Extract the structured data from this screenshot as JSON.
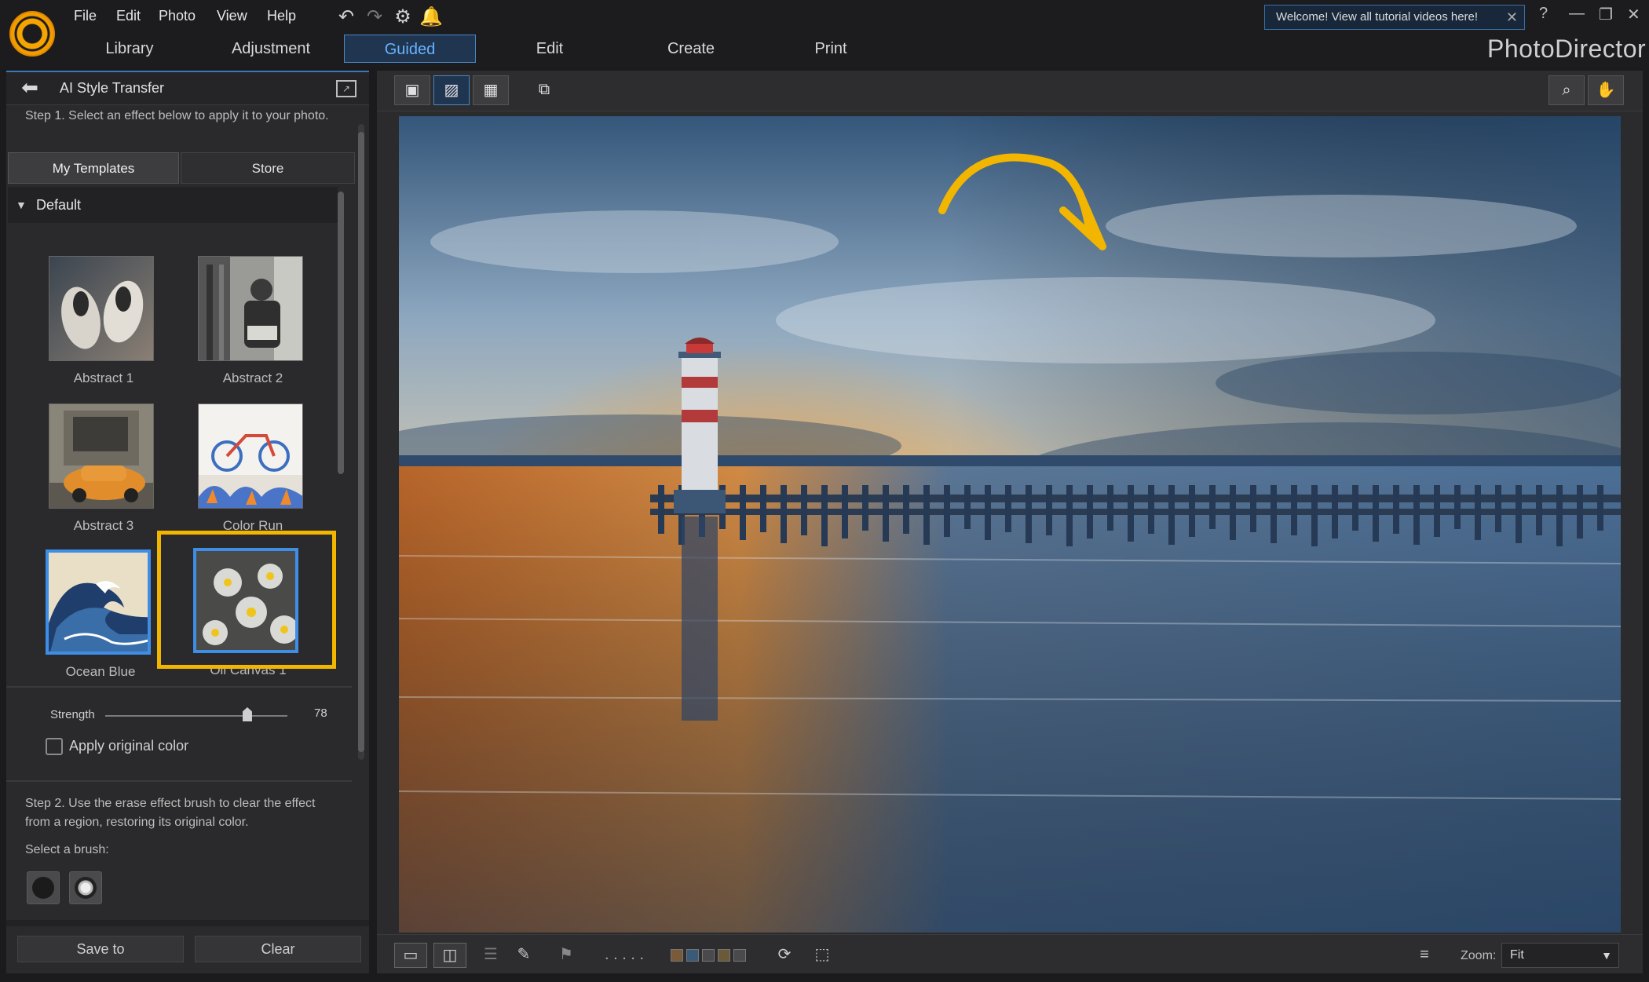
{
  "menu": [
    "File",
    "Edit",
    "Photo",
    "View",
    "Help"
  ],
  "tabs": [
    "Library",
    "Adjustment",
    "Guided",
    "Edit",
    "Create",
    "Print"
  ],
  "active_tab": "Guided",
  "welcome_tip": "Welcome! View all tutorial videos here!",
  "brand": "PhotoDirector",
  "panel": {
    "title": "AI Style Transfer",
    "step1": "Step 1. Select an effect below to apply it to your photo.",
    "subtabs": [
      "My Templates",
      "Store"
    ],
    "category": "Default",
    "templates": [
      "Abstract 1",
      "Abstract 2",
      "Abstract 3",
      "Color Run",
      "Ocean Blue",
      "Oil Canvas 1"
    ],
    "strength_label": "Strength",
    "strength_value": "78",
    "strength_fraction": 0.78,
    "apply_original_color": "Apply original color",
    "step2": "Step 2. Use the erase effect brush to clear the effect from a region, restoring its original color.",
    "select_brush": "Select a brush:",
    "save_to": "Save to",
    "clear": "Clear"
  },
  "viewer": {
    "zoom_label": "Zoom:",
    "zoom_value": "Fit",
    "flag_dots": ". . . . ."
  },
  "colors": {
    "accent_blue": "#3e8ee8",
    "highlight_yellow": "#f2b600"
  }
}
